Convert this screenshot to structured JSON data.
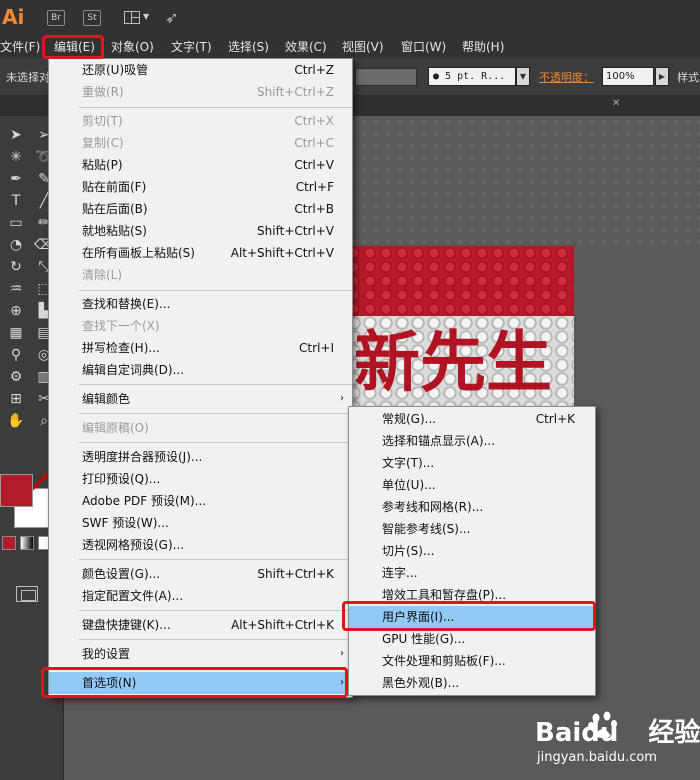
{
  "app": {
    "logo": "Ai",
    "bridge_btn": "Br",
    "stock_btn": "St"
  },
  "menubar": [
    {
      "label": "文件(F)",
      "id": "file"
    },
    {
      "label": "编辑(E)",
      "id": "edit"
    },
    {
      "label": "对象(O)",
      "id": "object"
    },
    {
      "label": "文字(T)",
      "id": "type"
    },
    {
      "label": "选择(S)",
      "id": "select"
    },
    {
      "label": "效果(C)",
      "id": "effect"
    },
    {
      "label": "视图(V)",
      "id": "view"
    },
    {
      "label": "窗口(W)",
      "id": "window"
    },
    {
      "label": "帮助(H)",
      "id": "help"
    }
  ],
  "controlbar": {
    "selection_label": "未选择对",
    "brush_value": "● 5 pt. R...",
    "opacity_label": "不透明度：",
    "opacity_value": "100%",
    "style_label": "样式"
  },
  "edit_menu": {
    "items": [
      {
        "label": "还原(U)吸管",
        "shortcut": "Ctrl+Z"
      },
      {
        "label": "重做(R)",
        "shortcut": "Shift+Ctrl+Z"
      },
      {
        "label": "剪切(T)",
        "shortcut": "Ctrl+X"
      },
      {
        "label": "复制(C)",
        "shortcut": "Ctrl+C"
      },
      {
        "label": "粘贴(P)",
        "shortcut": "Ctrl+V"
      },
      {
        "label": "贴在前面(F)",
        "shortcut": "Ctrl+F"
      },
      {
        "label": "贴在后面(B)",
        "shortcut": "Ctrl+B"
      },
      {
        "label": "就地粘贴(S)",
        "shortcut": "Shift+Ctrl+V"
      },
      {
        "label": "在所有画板上粘贴(S)",
        "shortcut": "Alt+Shift+Ctrl+V"
      },
      {
        "label": "清除(L)",
        "shortcut": ""
      },
      {
        "label": "查找和替换(E)...",
        "shortcut": ""
      },
      {
        "label": "查找下一个(X)",
        "shortcut": ""
      },
      {
        "label": "拼写检查(H)...",
        "shortcut": "Ctrl+I"
      },
      {
        "label": "编辑自定词典(D)...",
        "shortcut": ""
      },
      {
        "label": "编辑颜色",
        "shortcut": ""
      },
      {
        "label": "编辑原稿(O)",
        "shortcut": ""
      },
      {
        "label": "透明度拼合器预设(J)...",
        "shortcut": ""
      },
      {
        "label": "打印预设(Q)...",
        "shortcut": ""
      },
      {
        "label": "Adobe PDF 预设(M)...",
        "shortcut": ""
      },
      {
        "label": "SWF 预设(W)...",
        "shortcut": ""
      },
      {
        "label": "透视网格预设(G)...",
        "shortcut": ""
      },
      {
        "label": "颜色设置(G)...",
        "shortcut": "Shift+Ctrl+K"
      },
      {
        "label": "指定配置文件(A)...",
        "shortcut": ""
      },
      {
        "label": "键盘快捷键(K)...",
        "shortcut": "Alt+Shift+Ctrl+K"
      },
      {
        "label": "我的设置",
        "shortcut": ""
      },
      {
        "label": "首选项(N)",
        "shortcut": ""
      }
    ]
  },
  "prefs_submenu": {
    "items": [
      {
        "label": "常规(G)...",
        "shortcut": "Ctrl+K"
      },
      {
        "label": "选择和锚点显示(A)...",
        "shortcut": ""
      },
      {
        "label": "文字(T)...",
        "shortcut": ""
      },
      {
        "label": "单位(U)...",
        "shortcut": ""
      },
      {
        "label": "参考线和网格(R)...",
        "shortcut": ""
      },
      {
        "label": "智能参考线(S)...",
        "shortcut": ""
      },
      {
        "label": "切片(S)...",
        "shortcut": ""
      },
      {
        "label": "连字...",
        "shortcut": ""
      },
      {
        "label": "增效工具和暂存盘(P)...",
        "shortcut": ""
      },
      {
        "label": "用户界面(I)...",
        "shortcut": ""
      },
      {
        "label": "GPU 性能(G)...",
        "shortcut": ""
      },
      {
        "label": "文件处理和剪贴板(F)...",
        "shortcut": ""
      },
      {
        "label": "黑色外观(B)...",
        "shortcut": ""
      }
    ]
  },
  "artwork": {
    "text": "新先生"
  },
  "watermark": {
    "brand": "Baidu",
    "brand_cn": "经验",
    "url": "jingyan.baidu.com"
  },
  "colors": {
    "highlight": "#91c9f7",
    "annotation": "#e0161c",
    "fill_swatch": "#b01c2c"
  }
}
